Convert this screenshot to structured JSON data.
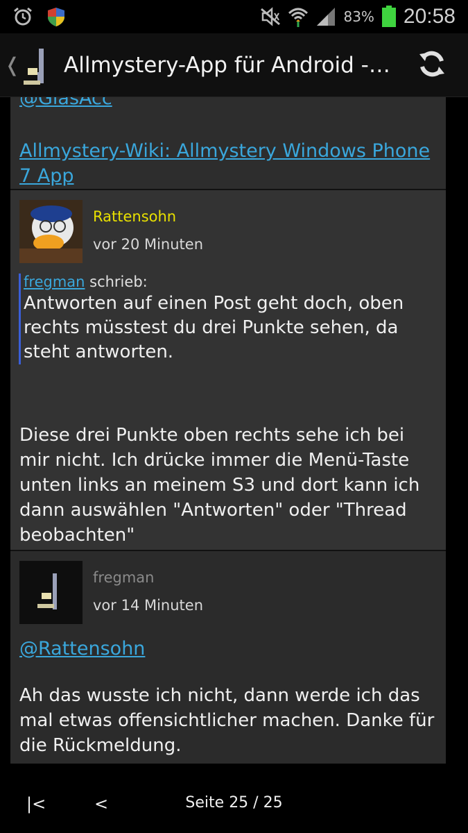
{
  "statusbar": {
    "battery_percent": "83%",
    "clock": "20:58"
  },
  "actionbar": {
    "title": "Allmystery-App für Android -…"
  },
  "posts": [
    {
      "cut_link": "@GlasAcc",
      "wiki_link": "Allmystery-Wiki: Allmystery Windows Phone 7 App"
    },
    {
      "author": "Rattensohn",
      "time": "vor 20 Minuten",
      "quote_author": "fregman",
      "quote_suffix": " schrieb:",
      "quote_text": "Antworten auf einen Post geht doch, oben rechts müsstest du drei Punkte sehen, da steht antworten.",
      "text": "Diese drei Punkte oben rechts sehe ich bei mir nicht. Ich drücke immer die Menü-Taste unten links an meinem S3 und dort kann ich dann auswählen \"Antworten\" oder \"Thread beobachten\""
    },
    {
      "author": "fregman",
      "time": "vor 14 Minuten",
      "mention": "@Rattensohn",
      "text": "Ah das wusste ich nicht, dann werde ich das mal etwas offensichtlicher machen. Danke für die Rückmeldung."
    }
  ],
  "bottom_nav": {
    "first_label": "|<",
    "prev_label": "<",
    "page_indicator": "Seite 25 / 25"
  }
}
